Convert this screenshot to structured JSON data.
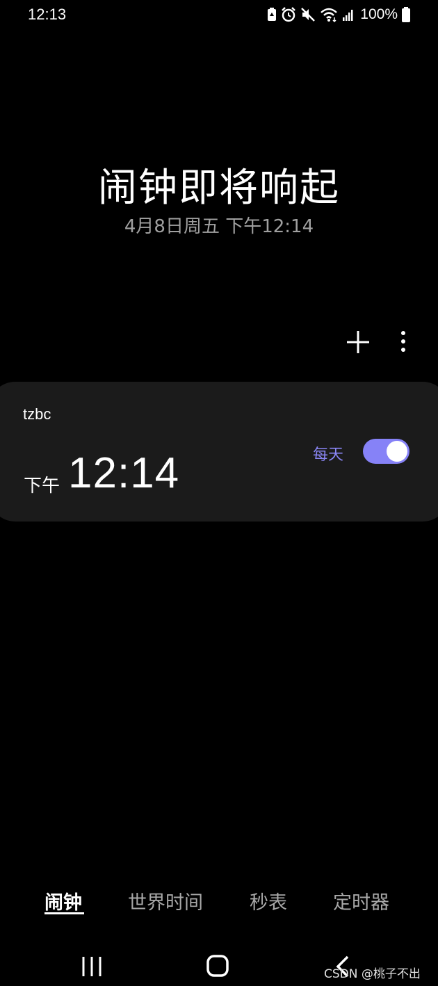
{
  "status_bar": {
    "time": "12:13",
    "battery_percent": "100%",
    "icons": [
      "battery-saver-icon",
      "alarm-icon",
      "mute-icon",
      "wifi-icon",
      "signal-icon",
      "battery-icon"
    ]
  },
  "header": {
    "title": "闹钟即将响起",
    "subtitle": "4月8日周五 下午12:14"
  },
  "toolbar": {
    "icons": [
      "add-icon",
      "more-vert-icon"
    ]
  },
  "alarm": {
    "name": "tzbc",
    "ampm": "下午",
    "time": "12:14",
    "repeat": "每天",
    "enabled": true
  },
  "tabs": [
    {
      "label": "闹钟",
      "active": true
    },
    {
      "label": "世界时间",
      "active": false
    },
    {
      "label": "秒表",
      "active": false
    },
    {
      "label": "定时器",
      "active": false
    }
  ],
  "nav_bar": {
    "icons": [
      "recents-icon",
      "home-icon",
      "back-icon"
    ]
  },
  "watermark": "CSDN @桃子不出",
  "colors": {
    "background": "#000000",
    "card": "#1b1b1b",
    "accent": "#8682f7",
    "subtitle": "#a0a0a0",
    "tab_inactive": "#a8a8a8"
  }
}
